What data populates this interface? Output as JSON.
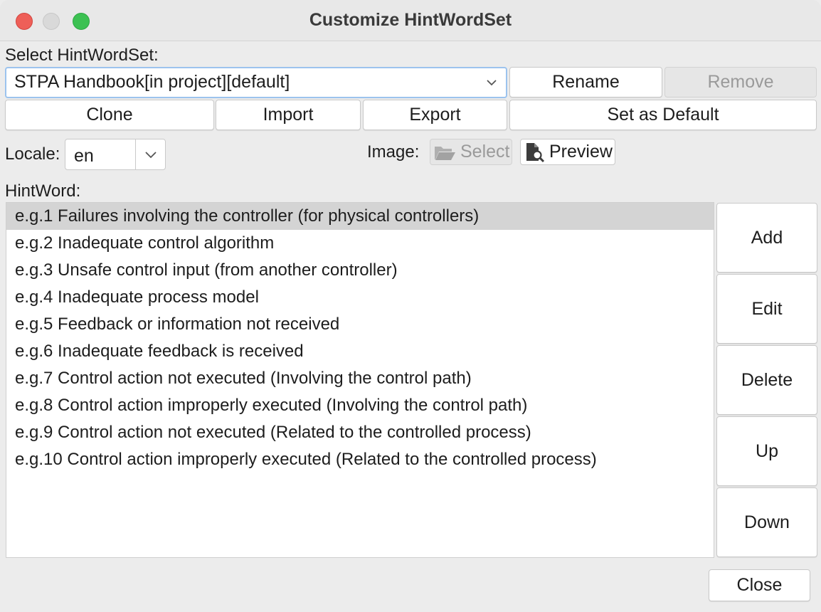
{
  "window": {
    "title": "Customize HintWordSet"
  },
  "select_hintwordset": {
    "label": "Select HintWordSet:",
    "selected_value": "STPA Handbook[in project][default]",
    "rename_label": "Rename",
    "remove_label": "Remove"
  },
  "actions": {
    "clone_label": "Clone",
    "import_label": "Import",
    "export_label": "Export",
    "set_default_label": "Set as Default"
  },
  "locale": {
    "label": "Locale:",
    "value": "en"
  },
  "image": {
    "label": "Image:",
    "select_label": "Select",
    "preview_label": "Preview"
  },
  "hintword": {
    "label": "HintWord:",
    "items": [
      "e.g.1 Failures involving the controller (for physical controllers)",
      "e.g.2 Inadequate control algorithm",
      "e.g.3 Unsafe control input (from another controller)",
      "e.g.4 Inadequate process model",
      "e.g.5 Feedback or information not received",
      "e.g.6 Inadequate feedback is received",
      "e.g.7 Control action not executed (Involving the control path)",
      "e.g.8 Control action improperly executed (Involving the control path)",
      "e.g.9 Control action not executed (Related to the controlled process)",
      "e.g.10 Control action improperly executed (Related to the controlled process)"
    ],
    "selected_index": 0
  },
  "side_buttons": {
    "add_label": "Add",
    "edit_label": "Edit",
    "delete_label": "Delete",
    "up_label": "Up",
    "down_label": "Down"
  },
  "footer": {
    "close_label": "Close"
  },
  "colors": {
    "close_light": "#ee5f58",
    "minimize_light": "#d9d9d9",
    "maximize_light": "#3cc152",
    "focus_ring": "#9cc3ee",
    "selection": "#d4d4d4"
  },
  "icons": {
    "window_close": "close-icon",
    "window_minimize": "minimize-icon",
    "window_maximize": "maximize-icon",
    "combo_arrow": "chevron-down-icon",
    "image_select": "folder-open-icon",
    "image_preview": "document-search-icon"
  }
}
